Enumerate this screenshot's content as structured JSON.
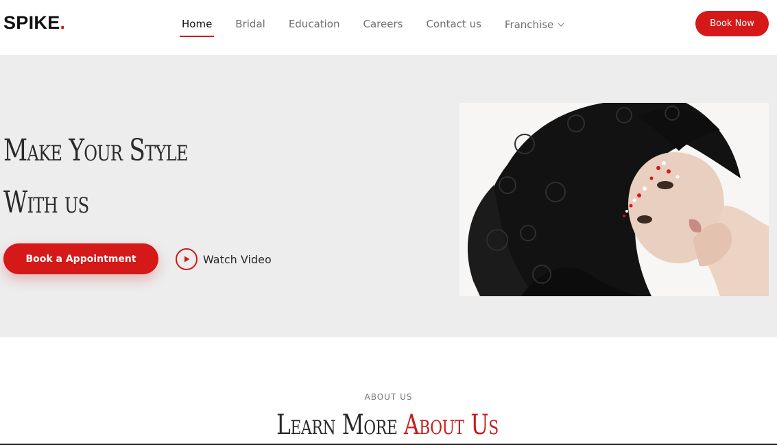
{
  "header": {
    "logo_text": "SPIKE",
    "logo_dot": ".",
    "nav": [
      {
        "label": "Home",
        "active": true
      },
      {
        "label": "Bridal",
        "active": false
      },
      {
        "label": "Education",
        "active": false
      },
      {
        "label": "Careers",
        "active": false
      },
      {
        "label": "Contact us",
        "active": false
      },
      {
        "label": "Franchise",
        "active": false,
        "has_dropdown": true
      }
    ],
    "book_now": "Book Now"
  },
  "hero": {
    "title_line1": "Make Your Style",
    "title_line2": "With us",
    "appointment_button": "Book a Appointment",
    "watch_video": "Watch Video",
    "image_icon": "woman-portrait-image"
  },
  "about": {
    "eyebrow": "ABOUT US",
    "title_main": "Learn More",
    "title_accent": "About Us"
  },
  "colors": {
    "accent": "#d51818",
    "hero_bg": "#ededed",
    "text": "#2a2a2a",
    "nav_text": "#6e6e73"
  }
}
